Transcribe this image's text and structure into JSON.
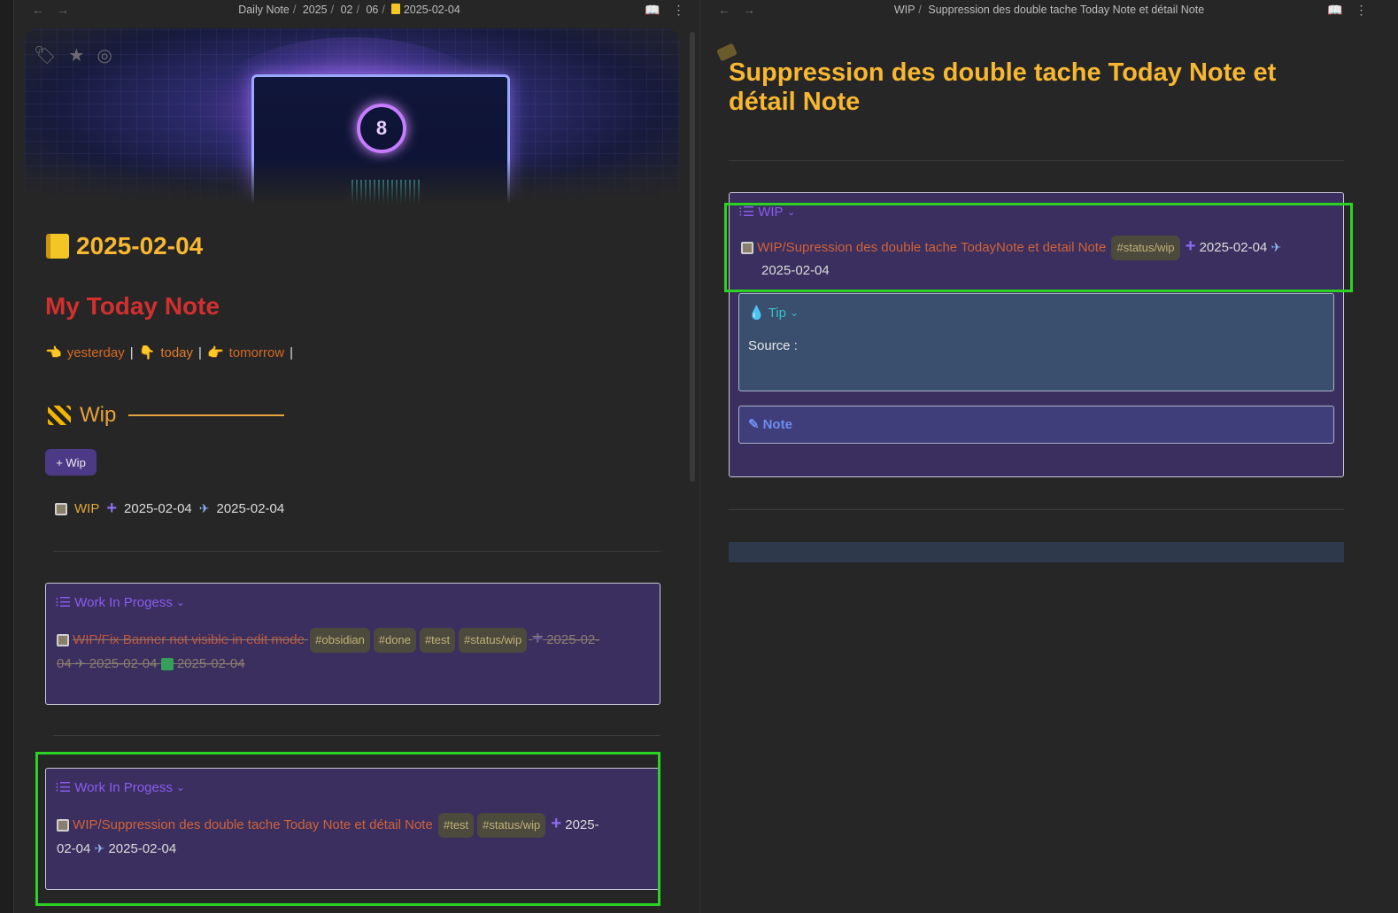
{
  "left": {
    "breadcrumbs": [
      "Daily Note",
      "2025",
      "02",
      "06",
      "2025-02-04"
    ],
    "date_heading": "2025-02-04",
    "today_title": "My Today Note",
    "nav": {
      "yesterday_emoji": "👈",
      "yesterday": "yesterday",
      "today_emoji": "👇",
      "today": "today",
      "tomorrow_emoji": "👉",
      "tomorrow": "tomorrow",
      "sep": "|"
    },
    "wip_heading": "Wip",
    "add_wip_button": "+ Wip",
    "task": {
      "label": "WIP",
      "created": "2025-02-04",
      "scheduled": "2025-02-04"
    },
    "callout1": {
      "title": "Work In Progess",
      "task_text": "WIP/Fix Banner not visible in edit mode",
      "tags": [
        "#obsidian",
        "#done",
        "#test",
        "#status/wip"
      ],
      "created": "2025-02-",
      "created2": "04",
      "scheduled": "2025-02-04",
      "done": "2025-02-04"
    },
    "callout2": {
      "title": "Work In Progess",
      "task_text": "WIP/Suppression des double tache Today Note et détail Note",
      "tags": [
        "#test",
        "#status/wip"
      ],
      "created": "2025-",
      "created2": "02-04",
      "scheduled": "2025-02-04"
    }
  },
  "right": {
    "breadcrumbs": [
      "WIP",
      "Suppression des double tache Today Note et détail Note"
    ],
    "title": "Suppression des double tache Today Note et détail Note",
    "wip_callout": {
      "title": "WIP",
      "task_text": "WIP/Supression des double tache TodayNote et detail Note",
      "tag": "#status/wip",
      "created": "2025-02-04",
      "scheduled": "2025-02-04"
    },
    "tip": {
      "title": "Tip",
      "body": "Source :"
    },
    "note": {
      "title": "Note"
    }
  },
  "colors": {
    "accent_yellow": "#f7b731",
    "heading_red": "#d2302f",
    "callout_bg": "#3a2f5e",
    "highlight_green": "#2bd223",
    "purple": "#8a5cf0"
  }
}
